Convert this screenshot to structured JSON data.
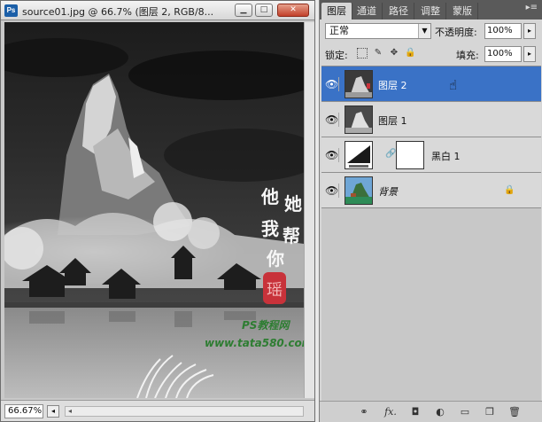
{
  "document": {
    "app_logo": "Ps",
    "title": "source01.jpg @ 66.7% (图层 2, RGB/8...",
    "window_buttons": {
      "minimize": "▁",
      "maximize": "□",
      "close": "✕"
    },
    "status_zoom": "66.67%",
    "status_nav": "◂",
    "scroll_arrow": "◂",
    "artwork_text": {
      "calligraphy_lines": [
        "他",
        "她",
        "我",
        "帮",
        "你"
      ],
      "seal": "瑶",
      "watermark_line1": "PS教程网",
      "watermark_line2": "www.tata580.com"
    }
  },
  "panel": {
    "tabs": [
      "图层",
      "通道",
      "路径",
      "调整",
      "蒙版"
    ],
    "active_tab_index": 0,
    "menu_button": "▸≡",
    "blend_mode": "正常",
    "blend_arrow": "▼",
    "opacity_label": "不透明度:",
    "opacity_value": "100%",
    "opacity_arrow": "▸",
    "lock_label": "锁定:",
    "lock_icons": [
      "lock-transparent-icon",
      "lock-brush-icon",
      "lock-move-icon",
      "lock-all-icon"
    ],
    "lock_glyphs": {
      "brush": "✎",
      "move": "✥",
      "all": "🔒"
    },
    "fill_label": "填充:",
    "fill_value": "100%",
    "fill_arrow": "▸",
    "layers": [
      {
        "name": "图层 2",
        "selected": true,
        "visible": true,
        "eye": "👁"
      },
      {
        "name": "图层 1",
        "selected": false,
        "visible": true,
        "eye": "👁"
      },
      {
        "name": "黑白 1",
        "selected": false,
        "visible": true,
        "eye": "👁",
        "type": "adjustment"
      },
      {
        "name": "背景",
        "selected": false,
        "visible": true,
        "eye": "👁",
        "locked": true
      }
    ],
    "background_lock_glyph": "🔒",
    "chain_glyph": "🔗",
    "cursor_glyph": "☝",
    "footer_icons": [
      {
        "name": "link-layers-icon",
        "glyph": "⚭"
      },
      {
        "name": "fx-icon",
        "glyph": "fx."
      },
      {
        "name": "add-mask-icon",
        "glyph": "◘"
      },
      {
        "name": "adjustment-layer-icon",
        "glyph": "◐"
      },
      {
        "name": "new-group-icon",
        "glyph": "▭"
      },
      {
        "name": "new-layer-icon",
        "glyph": "❐"
      },
      {
        "name": "delete-layer-icon",
        "glyph": "🗑"
      }
    ],
    "colors": {
      "selected_row": "#3a72c6",
      "tab_bar": "#5a5a5a"
    }
  }
}
